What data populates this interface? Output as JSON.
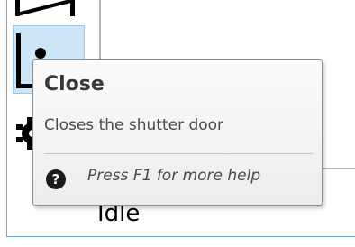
{
  "status": {
    "text": "Idle"
  },
  "toolbar": {
    "tools": [
      {
        "name": "open",
        "icon": "shutter-open-icon"
      },
      {
        "name": "close",
        "icon": "shutter-closed-icon",
        "selected": true
      },
      {
        "name": "settings",
        "icon": "gear-icon"
      }
    ]
  },
  "tooltip": {
    "title": "Close",
    "description": "Closes the shutter door",
    "help": "Press F1 for more help",
    "help_icon": "question-circle-icon"
  },
  "colors": {
    "selection_fill": "#cde6f7",
    "selection_border": "#99c9ef",
    "frame_border": "#6ea8d9"
  }
}
